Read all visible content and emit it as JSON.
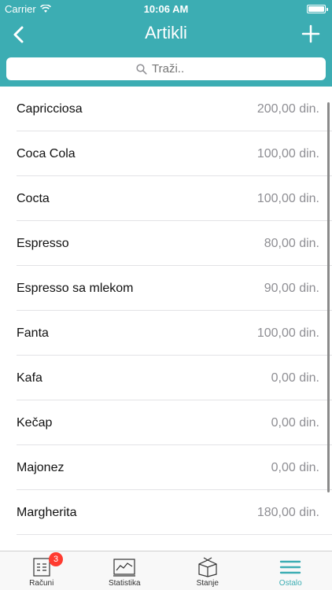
{
  "status_bar": {
    "carrier": "Carrier",
    "time": "10:06 AM"
  },
  "nav": {
    "title": "Artikli"
  },
  "search": {
    "placeholder": "Traži.."
  },
  "items": [
    {
      "name": "Capricciosa",
      "price": "200,00 din."
    },
    {
      "name": "Coca Cola",
      "price": "100,00 din."
    },
    {
      "name": "Cocta",
      "price": "100,00 din."
    },
    {
      "name": "Espresso",
      "price": "80,00 din."
    },
    {
      "name": "Espresso sa mlekom",
      "price": "90,00 din."
    },
    {
      "name": "Fanta",
      "price": "100,00 din."
    },
    {
      "name": "Kafa",
      "price": "0,00 din."
    },
    {
      "name": "Kečap",
      "price": "0,00 din."
    },
    {
      "name": "Majonez",
      "price": "0,00 din."
    },
    {
      "name": "Margherita",
      "price": "180,00 din."
    }
  ],
  "tabs": [
    {
      "label": "Računi",
      "icon": "receipt-icon",
      "badge": "3"
    },
    {
      "label": "Statistika",
      "icon": "chart-icon"
    },
    {
      "label": "Stanje",
      "icon": "box-icon"
    },
    {
      "label": "Ostalo",
      "icon": "menu-icon",
      "active": true
    }
  ],
  "colors": {
    "accent": "#3cadb3",
    "badge": "#ff3b30"
  }
}
